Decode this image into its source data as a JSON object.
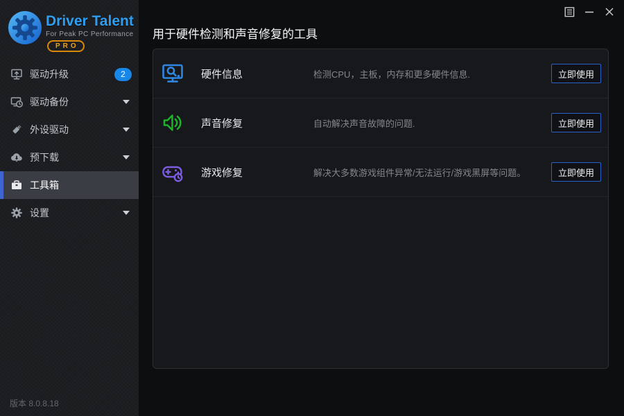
{
  "window": {
    "controls": {
      "menu": "menu",
      "minimize": "minimize",
      "close": "close"
    }
  },
  "sidebar": {
    "logo": {
      "title": "Driver Talent",
      "subtitle": "For Peak PC Performance",
      "edition": "PRO"
    },
    "items": [
      {
        "label": "驱动升级",
        "icon": "monitor-upgrade-icon",
        "badge": "2",
        "selected": false
      },
      {
        "label": "驱动备份",
        "icon": "monitor-backup-icon",
        "expandable": true,
        "selected": false
      },
      {
        "label": "外设驱动",
        "icon": "usb-drive-icon",
        "expandable": true,
        "selected": false
      },
      {
        "label": "预下载",
        "icon": "cloud-download-icon",
        "expandable": true,
        "selected": false
      },
      {
        "label": "工具箱",
        "icon": "toolbox-icon",
        "selected": true
      },
      {
        "label": "设置",
        "icon": "gear-icon",
        "expandable": true,
        "selected": false
      }
    ],
    "version": "版本 8.0.8.18"
  },
  "main": {
    "title": "用于硬件检测和声音修复的工具",
    "tools": [
      {
        "name": "硬件信息",
        "description": "检测CPU，主板，内存和更多硬件信息.",
        "icon": "hardware-info-icon",
        "icon_color": "#2e86e0",
        "action": "立即使用"
      },
      {
        "name": "声音修复",
        "description": "自动解决声音故障的问题.",
        "icon": "sound-repair-icon",
        "icon_color": "#1db22a",
        "action": "立即使用"
      },
      {
        "name": "游戏修复",
        "description": "解决大多数游戏组件异常/无法运行/游戏黑屏等问题。",
        "icon": "game-repair-icon",
        "icon_color": "#7c5ce0",
        "action": "立即使用"
      }
    ]
  },
  "colors": {
    "accent_blue": "#2a62cc",
    "badge_blue": "#1787ea",
    "selected_border": "#3f66d0",
    "pro_orange": "#f0a11a",
    "sidebar_bg": "#1b1c1f",
    "panel_bg": "#17181b",
    "main_bg": "#0d0e10"
  }
}
